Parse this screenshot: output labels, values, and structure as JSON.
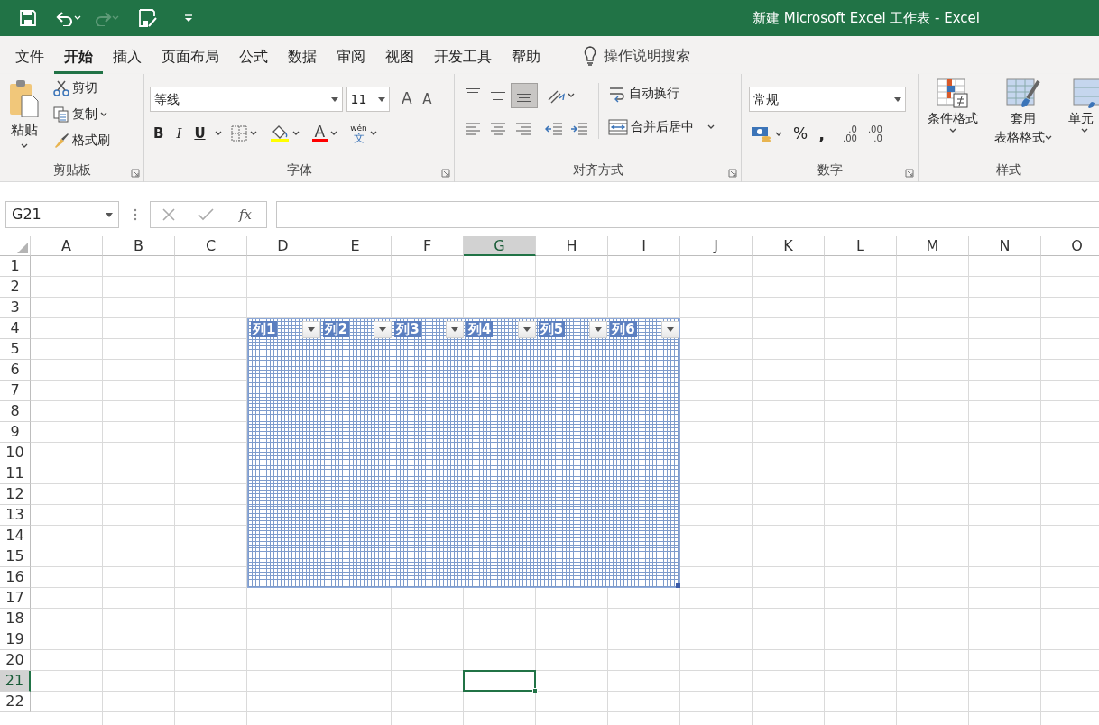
{
  "title_bar": {
    "title": "新建 Microsoft Excel 工作表  -  Excel",
    "redo_disabled": true
  },
  "menu_tabs": [
    {
      "label": "文件",
      "selected": false
    },
    {
      "label": "开始",
      "selected": true
    },
    {
      "label": "插入",
      "selected": false
    },
    {
      "label": "页面布局",
      "selected": false
    },
    {
      "label": "公式",
      "selected": false
    },
    {
      "label": "数据",
      "selected": false
    },
    {
      "label": "审阅",
      "selected": false
    },
    {
      "label": "视图",
      "selected": false
    },
    {
      "label": "开发工具",
      "selected": false
    },
    {
      "label": "帮助",
      "selected": false
    }
  ],
  "tell_me": {
    "placeholder": "操作说明搜索"
  },
  "ribbon": {
    "clipboard": {
      "paste": "粘贴",
      "cut": "剪切",
      "copy": "复制",
      "format_painter": "格式刷",
      "label": "剪贴板"
    },
    "font": {
      "font_name": "等线",
      "font_size": "11",
      "grow": "A",
      "shrink": "A",
      "bold": "B",
      "italic": "I",
      "underline": "U",
      "font_color": "A",
      "phonetic": [
        "wén",
        "文"
      ],
      "label": "字体"
    },
    "alignment": {
      "vertical": [
        {
          "selected": false
        },
        {
          "selected": false
        },
        {
          "selected": true
        }
      ],
      "wrap_text": "自动换行",
      "merge_center": "合并后居中",
      "label": "对齐方式"
    },
    "number": {
      "format": "常规",
      "percent": "%",
      "comma": ",",
      "increase_decimal": [
        ".0",
        ".00"
      ],
      "decrease_decimal": [
        ".00",
        ".0"
      ],
      "label": "数字"
    },
    "styles": {
      "conditional": "条件格式",
      "format_table": [
        "套用",
        "表格格式"
      ],
      "cell_styles": "单元",
      "label": "样式"
    }
  },
  "formula_bar": {
    "name_box": "G21",
    "fx": "fx"
  },
  "sheet": {
    "columns": [
      {
        "label": "A",
        "selected": false,
        "in_table": false
      },
      {
        "label": "B",
        "selected": false,
        "in_table": false
      },
      {
        "label": "C",
        "selected": false,
        "in_table": false
      },
      {
        "label": "D",
        "selected": false,
        "in_table": true
      },
      {
        "label": "E",
        "selected": false,
        "in_table": true
      },
      {
        "label": "F",
        "selected": false,
        "in_table": true
      },
      {
        "label": "G",
        "selected": true,
        "in_table": true
      },
      {
        "label": "H",
        "selected": false,
        "in_table": true
      },
      {
        "label": "I",
        "selected": false,
        "in_table": true
      },
      {
        "label": "J",
        "selected": false,
        "in_table": false
      },
      {
        "label": "K",
        "selected": false,
        "in_table": false
      },
      {
        "label": "L",
        "selected": false,
        "in_table": false
      },
      {
        "label": "M",
        "selected": false,
        "in_table": false
      },
      {
        "label": "N",
        "selected": false,
        "in_table": false
      },
      {
        "label": "O",
        "selected": false,
        "in_table": false
      }
    ],
    "rows": [
      {
        "label": "1",
        "selected": false,
        "in_table": false
      },
      {
        "label": "2",
        "selected": false,
        "in_table": false
      },
      {
        "label": "3",
        "selected": false,
        "in_table": false
      },
      {
        "label": "4",
        "selected": false,
        "in_table": true
      },
      {
        "label": "5",
        "selected": false,
        "in_table": true
      },
      {
        "label": "6",
        "selected": false,
        "in_table": true
      },
      {
        "label": "7",
        "selected": false,
        "in_table": true
      },
      {
        "label": "8",
        "selected": false,
        "in_table": true
      },
      {
        "label": "9",
        "selected": false,
        "in_table": true
      },
      {
        "label": "10",
        "selected": false,
        "in_table": true
      },
      {
        "label": "11",
        "selected": false,
        "in_table": true
      },
      {
        "label": "12",
        "selected": false,
        "in_table": true
      },
      {
        "label": "13",
        "selected": false,
        "in_table": true
      },
      {
        "label": "14",
        "selected": false,
        "in_table": true
      },
      {
        "label": "15",
        "selected": false,
        "in_table": true
      },
      {
        "label": "16",
        "selected": false,
        "in_table": true
      },
      {
        "label": "17",
        "selected": false,
        "in_table": false
      },
      {
        "label": "18",
        "selected": false,
        "in_table": false
      },
      {
        "label": "19",
        "selected": false,
        "in_table": false
      },
      {
        "label": "20",
        "selected": false,
        "in_table": false
      },
      {
        "label": "21",
        "selected": true,
        "in_table": false
      },
      {
        "label": "22",
        "selected": false,
        "in_table": false
      }
    ],
    "table": {
      "headers": [
        "列1",
        "列2",
        "列3",
        "列4",
        "列5",
        "列6"
      ]
    }
  }
}
